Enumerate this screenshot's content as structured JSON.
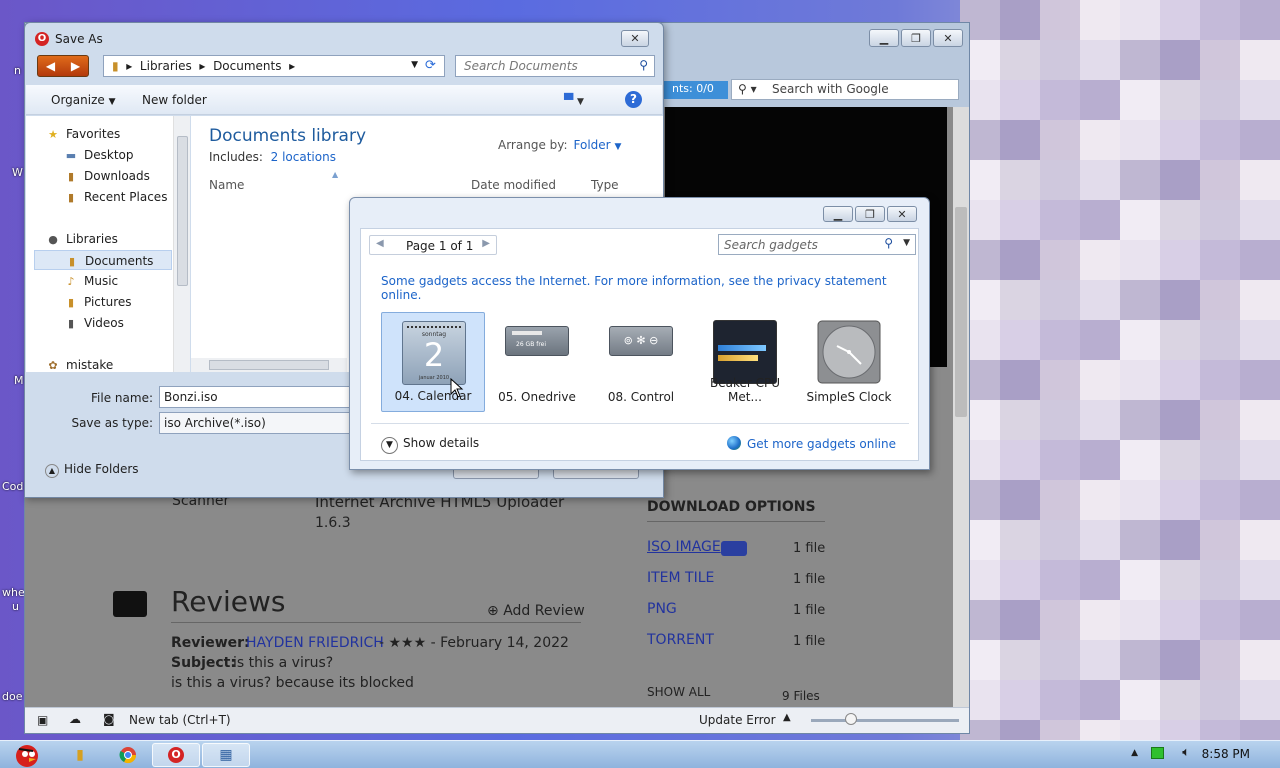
{
  "desktop": {
    "labels": [
      "n",
      "W",
      "M",
      "Cod",
      "whe",
      "u",
      "doe"
    ]
  },
  "browser": {
    "search_placeholder": "Search with Google",
    "downloads_counter": "nts: 0/0",
    "page": {
      "scanner_label": "Scanner",
      "uploader_text": "Internet Archive HTML5 Uploader",
      "uploader_version": "1.6.3",
      "reviews_heading": "Reviews",
      "add_review": "Add Review",
      "reviewer_label": "Reviewer:",
      "reviewer_name": "HAYDEN FRIEDRICH",
      "review_meta": " - ★★★ - February 14, 2022",
      "subject_label": "Subject:",
      "subject_value": "is this a virus?",
      "review_body": "is this a virus? because its blocked",
      "download_options_heading": "DOWNLOAD OPTIONS",
      "downloads": [
        {
          "label": "ISO IMAGE",
          "count": "1 file"
        },
        {
          "label": "ITEM TILE",
          "count": "1 file"
        },
        {
          "label": "PNG",
          "count": "1 file"
        },
        {
          "label": "TORRENT",
          "count": "1 file"
        }
      ],
      "show_all": "SHOW ALL",
      "show_all_count": "9 Files"
    },
    "statusbar": {
      "new_tab": "New tab (Ctrl+T)",
      "update_error": "Update Error"
    }
  },
  "save_dialog": {
    "title": "Save As",
    "breadcrumb": [
      "Libraries",
      "Documents"
    ],
    "search_placeholder": "Search Documents",
    "toolbar": {
      "organize": "Organize",
      "new_folder": "New folder"
    },
    "nav": {
      "favorites": "Favorites",
      "desktop": "Desktop",
      "downloads": "Downloads",
      "recent_places": "Recent Places",
      "libraries": "Libraries",
      "documents": "Documents",
      "music": "Music",
      "pictures": "Pictures",
      "videos": "Videos",
      "mistake": "mistake"
    },
    "library_title": "Documents library",
    "includes_label": "Includes:",
    "includes_link": "2 locations",
    "arrange_label": "Arrange by:",
    "arrange_value": "Folder",
    "columns": [
      "Name",
      "Date modified",
      "Type"
    ],
    "file_name_label": "File name:",
    "file_name_value": "Bonzi.iso",
    "save_type_label": "Save as type:",
    "save_type_value": "iso Archive(*.iso)",
    "hide_folders": "Hide Folders"
  },
  "gadget_gallery": {
    "pager": "Page 1 of 1",
    "search_placeholder": "Search gadgets",
    "notice": "Some gadgets access the Internet.  For more information, see the privacy statement online.",
    "items": [
      {
        "label": "04. Calendar",
        "icon": "calendar-gadget-icon",
        "calendar_top": "sonntag",
        "calendar_day": "2",
        "calendar_bottom": "januar 2010"
      },
      {
        "label": "05. Onedrive",
        "icon": "onedrive-gadget-icon",
        "drive_text": "26 GB frei"
      },
      {
        "label": "08. Control",
        "icon": "control-gadget-icon"
      },
      {
        "label": "Beaker CPU Met...",
        "icon": "cpu-meter-gadget-icon"
      },
      {
        "label": "SimpleS Clock",
        "icon": "clock-gadget-icon"
      }
    ],
    "show_details": "Show details",
    "get_more": "Get more gadgets online"
  },
  "taskbar": {
    "clock": "8:58 PM"
  },
  "colors": {
    "link": "#1c64c9",
    "library_title": "#1e5b9e",
    "opera_red": "#d42424"
  }
}
